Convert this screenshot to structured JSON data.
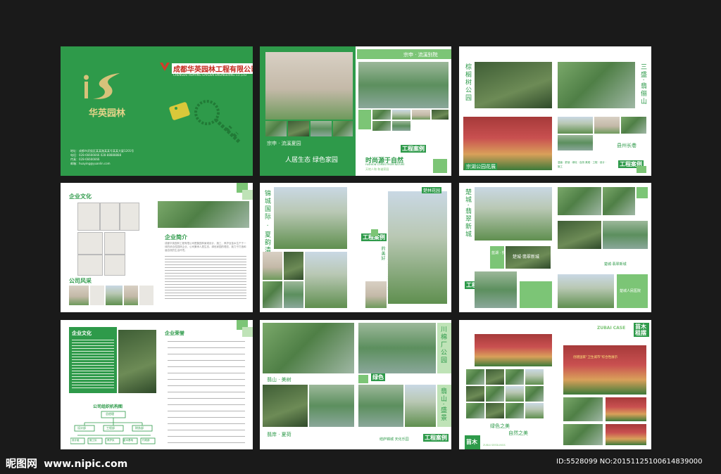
{
  "pages": {
    "p1": {
      "company_name": "成都华英园林工程有限公司",
      "company_name_en": "CHENGDU HUAYING GARDEN ENGINEERING CO.,LTD",
      "logo_text": "华英园林",
      "contact_lines": [
        "地址：成都市武侯区某某路某某号某某大厦1201号",
        "电话：028-66666666  028-88888888",
        "传真：028-66666666",
        "邮箱：huaying@yuanlin.com"
      ]
    },
    "p2": {
      "top_label": "宗申 · 流溪别院",
      "bottom_label": "宗申 · 流溪夏园",
      "slogan": "人居生态  绿色家园",
      "motto": "时尚源于自然",
      "motto_en": "FASHION COMES FROM NATURE",
      "motto_sub": "天地人和   和谐家园",
      "badge": "工程案例"
    },
    "p3": {
      "vtext_left": "棕榈树公园",
      "vtext_right": "三盛·翡俪山",
      "label_left": "宗湖公园花展",
      "label_right": "县州长巷",
      "caption": "温馨 · 舒适 · 绿化 · 自然  美观 · 工程 · 设计 · 施工",
      "badge": "工程案例"
    },
    "p4": {
      "heading_culture": "企业文化",
      "heading_intro": "企业简介",
      "heading_style": "公司风采",
      "body_text": "成都华英园林工程有限公司是集园林景观设计、施工、养护及苗木生产于一体的综合性园林企业，公司秉承人居生态、绿色家园的理念，致力于打造和谐自然的生活环境。"
    },
    "p5": {
      "vtext_left": "锦城国际 · 夏韵清江",
      "top_label": "楚林花园",
      "badge": "工程案例",
      "vtext_mid": "以园林生态为本演绎自然的美好"
    },
    "p6": {
      "vtext_top": "楚城·翡翠新城",
      "label_mid": "蓝湖 · 悦城",
      "label_photo": "楚城·翡翠新城",
      "label_right_mid": "楚城·翡翠新城",
      "label_right_bottom": "楚城人民医院",
      "vtext_pair": [
        "人民",
        "医院"
      ],
      "badge": "工程案例"
    },
    "p7": {
      "heading_culture": "企业文化",
      "heading_org": "公司组织机构图",
      "heading_right": "企业荣誉",
      "org_top": "总经理",
      "org_mid": [
        "设计部",
        "工程部",
        "财务部"
      ],
      "org_bottom": [
        "设计组",
        "施工队",
        "养护队",
        "苗木基地",
        "行政部"
      ]
    },
    "p8": {
      "vtext_right_top": "川棉厂公园",
      "label_left_mid": "翡山 · 美树",
      "label_left_bottom": "翡岸 · 夏荷",
      "badge_mid": "绿色",
      "vtext_right_bottom": "翡山·盛景",
      "caption": "结庐锦城  天化乐园",
      "badge": "工程案例"
    },
    "p9": {
      "header_en": "ZUBAI CASE",
      "badge": "苗木租摆",
      "caption_center_1": "绿色之美",
      "caption_center_2": "自然之美",
      "banner_text": "创建国家“卫生城市”综合性展示",
      "footer_left": "苗木",
      "footer_left_en": "ZUBAI SEEDLINGS"
    }
  },
  "watermark": {
    "site_name": "昵图网",
    "site_url": "www.nipic.com",
    "id_text": "ID:5528099 NO:20151125100614839000"
  },
  "colors": {
    "brand_green": "#2e9a4a",
    "light_green": "#7cc576",
    "pale_green": "#bfe3b7",
    "background": "#1a1a1a"
  }
}
